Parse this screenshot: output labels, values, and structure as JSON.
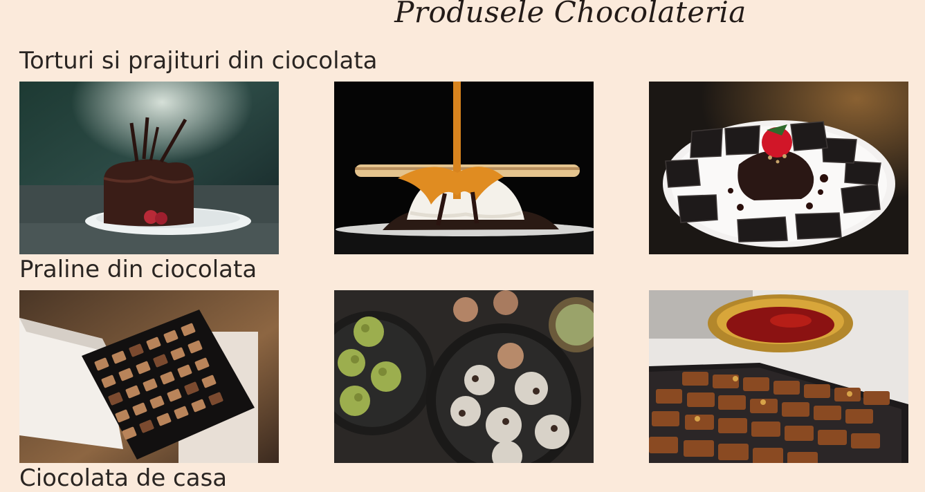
{
  "page": {
    "title": "Produsele Chocolateria"
  },
  "sections": [
    {
      "heading": "Torturi si prajituri din ciocolata",
      "photos": [
        {
          "icon": "chocolate-cake-photo"
        },
        {
          "icon": "ice-cream-caramel-photo"
        },
        {
          "icon": "chocolate-cake-plate-photo"
        }
      ]
    },
    {
      "heading": "Praline din ciocolata",
      "photos": [
        {
          "icon": "praline-box-photo"
        },
        {
          "icon": "truffles-photo"
        },
        {
          "icon": "chocolate-tray-tea-photo"
        }
      ]
    },
    {
      "heading": "Ciocolata de casa"
    }
  ],
  "colors": {
    "background": "#fbeadb",
    "text": "#2c2623"
  }
}
